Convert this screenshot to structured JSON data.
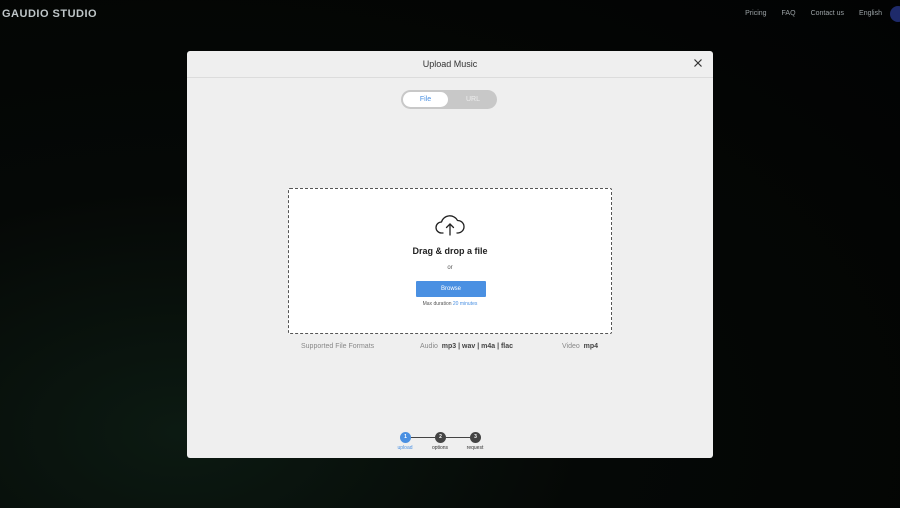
{
  "app": {
    "logo": "GAUDIO STUDIO"
  },
  "nav": {
    "items": [
      "Pricing",
      "FAQ",
      "Contact us",
      "English"
    ]
  },
  "modal": {
    "title": "Upload Music",
    "tabs": {
      "file": "File",
      "url": "URL"
    },
    "dropzone": {
      "icon": "cloud-upload-icon",
      "title": "Drag & drop a file",
      "or": "or",
      "browse": "Browse",
      "max_duration_prefix": "Max duration",
      "max_duration_value": "20 minutes"
    },
    "formats": {
      "label": "Supported File Formats",
      "audio_label": "Audio",
      "audio_values": "mp3 | wav | m4a | flac",
      "video_label": "Video",
      "video_values": "mp4"
    },
    "steps": [
      {
        "num": "1",
        "label": "upload"
      },
      {
        "num": "2",
        "label": "options"
      },
      {
        "num": "3",
        "label": "request"
      }
    ]
  },
  "colors": {
    "accent": "#4a90e2",
    "step_inactive": "#444444"
  }
}
